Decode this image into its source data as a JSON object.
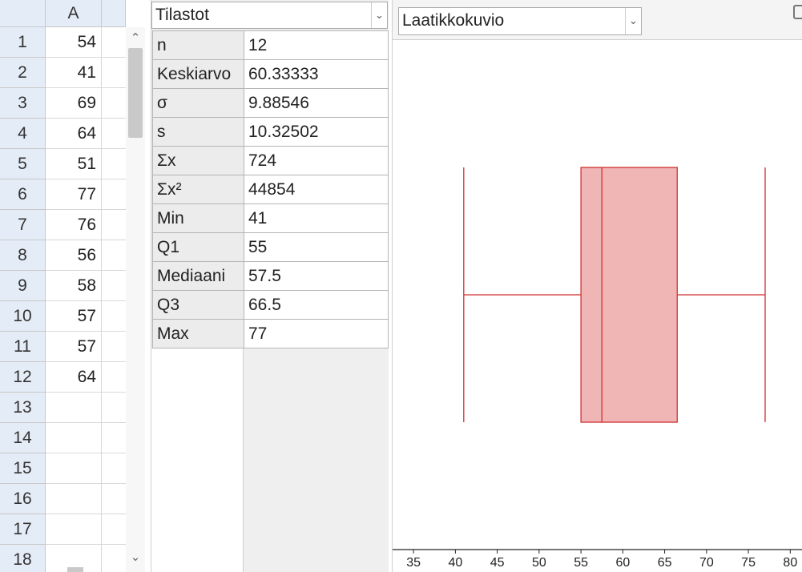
{
  "spreadsheet": {
    "column": "A",
    "rows": [
      {
        "num": "1",
        "value": "54"
      },
      {
        "num": "2",
        "value": "41"
      },
      {
        "num": "3",
        "value": "69"
      },
      {
        "num": "4",
        "value": "64"
      },
      {
        "num": "5",
        "value": "51"
      },
      {
        "num": "6",
        "value": "77"
      },
      {
        "num": "7",
        "value": "76"
      },
      {
        "num": "8",
        "value": "56"
      },
      {
        "num": "9",
        "value": "58"
      },
      {
        "num": "10",
        "value": "57"
      },
      {
        "num": "11",
        "value": "57"
      },
      {
        "num": "12",
        "value": "64"
      },
      {
        "num": "13",
        "value": ""
      },
      {
        "num": "14",
        "value": ""
      },
      {
        "num": "15",
        "value": ""
      },
      {
        "num": "16",
        "value": ""
      },
      {
        "num": "17",
        "value": ""
      },
      {
        "num": "18",
        "value": ""
      }
    ],
    "scroll_up_icon": "chevron-up-icon",
    "scroll_down_icon": "chevron-down-icon"
  },
  "stats": {
    "selected": "Tilastot",
    "rows": [
      {
        "label": "n",
        "value": "12"
      },
      {
        "label": "Keskiarvo",
        "value": "60.33333"
      },
      {
        "label": "σ",
        "value": "9.88546"
      },
      {
        "label": "s",
        "value": "10.32502"
      },
      {
        "label": "Σx",
        "value": "724"
      },
      {
        "label": "Σx²",
        "value": "44854"
      },
      {
        "label": "Min",
        "value": "41"
      },
      {
        "label": "Q1",
        "value": "55"
      },
      {
        "label": "Mediaani",
        "value": "57.5"
      },
      {
        "label": "Q3",
        "value": "66.5"
      },
      {
        "label": "Max",
        "value": "77"
      }
    ]
  },
  "chart_panel": {
    "selected": "Laatikkokuvio"
  },
  "chart_data": {
    "type": "box",
    "min": 41,
    "q1": 55,
    "median": 57.5,
    "q3": 66.5,
    "max": 77,
    "xlim": [
      32.5,
      81.5
    ],
    "x_ticks": [
      35,
      40,
      45,
      50,
      55,
      60,
      65,
      70,
      75,
      80
    ],
    "box_fill": "#f0b5b5",
    "stroke": "#d03030"
  },
  "colors": {
    "header_bg": "#e4ecf7",
    "panel_bg": "#efefef"
  }
}
